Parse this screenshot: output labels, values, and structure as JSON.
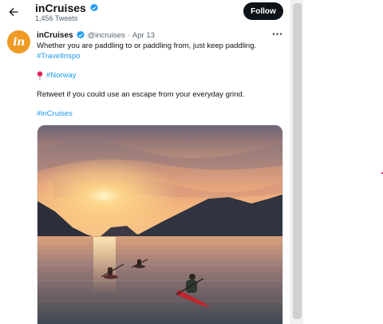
{
  "header": {
    "title": "inCruises",
    "tweet_count": "1,456 Tweets",
    "follow_label": "Follow",
    "back_icon": "arrow-left-icon",
    "verified_icon": "verified-badge-icon"
  },
  "tweet": {
    "author_name": "inCruises",
    "handle": "@incruises",
    "separator": "·",
    "date": "Apr 13",
    "more_icon": "more-horizontal-icon",
    "line1": "Whether you are paddling to or paddling from, just keep paddling.",
    "hashtag1": "#TravelInspo",
    "pin_icon": "round-pushpin-icon",
    "hashtag2": "#Norway",
    "line2": "Retweet if you could use an escape from your everyday grind.",
    "hashtag3": "#inCruises",
    "media_icon": "kayak-sunset-photo"
  },
  "colors": {
    "accent": "#1d9bf0",
    "brand_orange": "#f09a24",
    "follow_bg": "#0f1419",
    "muted": "#536471"
  }
}
